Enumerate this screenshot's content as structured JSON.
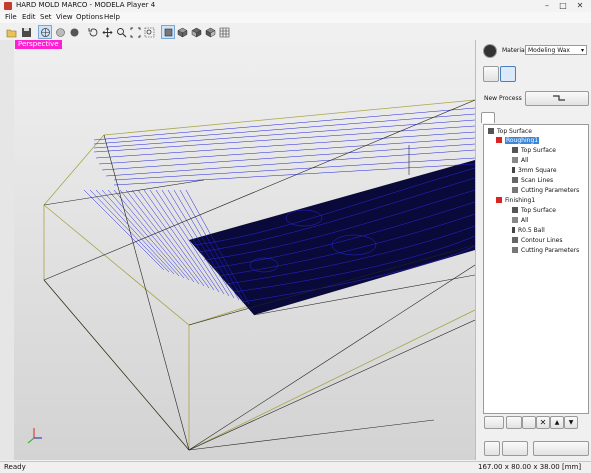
{
  "window": {
    "title": "HARD MOLD MARCO - MODELA Player 4"
  },
  "menu": [
    "File",
    "Edit",
    "Set",
    "View",
    "Options",
    "Help"
  ],
  "toolbar_icons": [
    "open-folder-icon",
    "save-icon",
    "globe-icon",
    "sphere-icon",
    "sphere-dark-icon",
    "rotate-icon",
    "pan-icon",
    "zoom-icon",
    "fit-icon",
    "zoom-window-icon",
    "cube-front-icon",
    "cube-top-icon",
    "cube-side-icon",
    "cube-iso-icon",
    "grid-icon"
  ],
  "viewport": {
    "label": "Perspective",
    "label_color": "#ff1fd2"
  },
  "panel": {
    "material_label": "Material",
    "material_value": "Modeling Wax",
    "new_process_label": "New Process",
    "tree": [
      {
        "label": "Top Surface",
        "level": 0,
        "type": "root"
      },
      {
        "label": "Roughing1",
        "level": 1,
        "type": "process",
        "selected": true
      },
      {
        "label": "Top Surface",
        "level": 2,
        "type": "item"
      },
      {
        "label": "All",
        "level": 2,
        "type": "item"
      },
      {
        "label": "3mm Square",
        "level": 2,
        "type": "item"
      },
      {
        "label": "Scan Lines",
        "level": 2,
        "type": "item"
      },
      {
        "label": "Cutting Parameters",
        "level": 2,
        "type": "item"
      },
      {
        "label": "Finishing1",
        "level": 1,
        "type": "process"
      },
      {
        "label": "Top Surface",
        "level": 2,
        "type": "item"
      },
      {
        "label": "All",
        "level": 2,
        "type": "item"
      },
      {
        "label": "R0.5 Ball",
        "level": 2,
        "type": "item"
      },
      {
        "label": "Contour Lines",
        "level": 2,
        "type": "item"
      },
      {
        "label": "Cutting Parameters",
        "level": 2,
        "type": "item"
      }
    ]
  },
  "status": {
    "left": "Ready",
    "right": "167.00 x 80.00 x 38.00 [mm]"
  },
  "colors": {
    "toolpath": "#1a1acc",
    "stock": "#a8a54a",
    "selection": "#3b86d9"
  }
}
